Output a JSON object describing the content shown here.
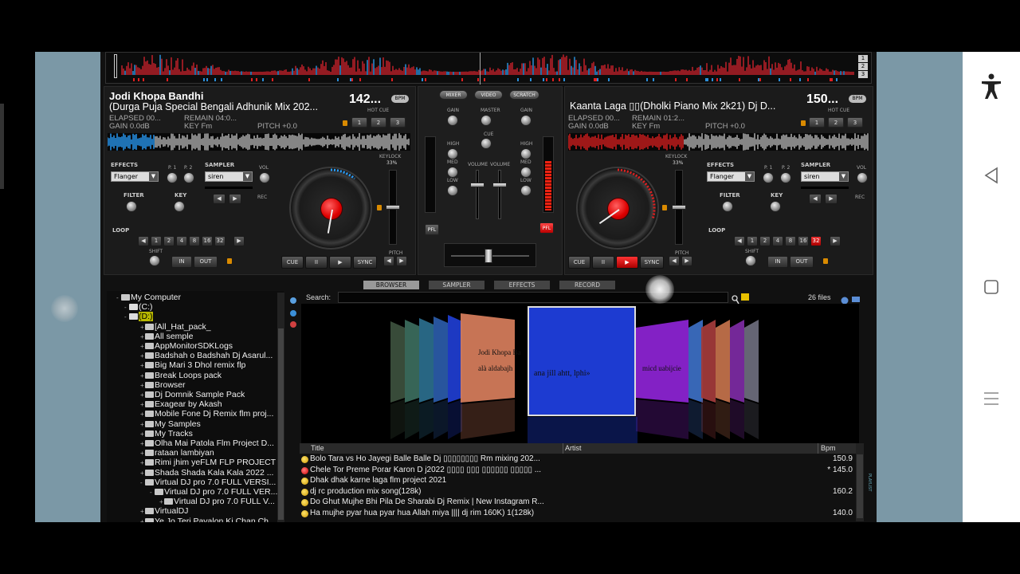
{
  "deck_left": {
    "title": "Jodi Khopa Bandhi",
    "subtitle": "(Durga Puja Special Bengali Adhunik Mix 202...",
    "bpm": "142...",
    "bpm_tag": "BPM",
    "elapsed": "ELAPSED 00...",
    "remain": "REMAIN 04:0...",
    "gain": "GAIN 0.0dB",
    "key": "KEY Fm",
    "pitch": "PITCH +0.0",
    "hotcue_label": "HOT CUE",
    "hotcues": [
      "1",
      "2",
      "3"
    ],
    "effects_label": "EFFECTS",
    "effect": "Flanger",
    "p1": "P. 1",
    "p2": "P. 2",
    "sampler_label": "SAMPLER",
    "sampler": "siren",
    "vol_label": "VOL",
    "filter_label": "FILTER",
    "key_label": "KEY",
    "rec_label": "REC",
    "loop_label": "LOOP",
    "loop_values": [
      "1",
      "2",
      "4",
      "8",
      "16",
      "32"
    ],
    "shift_label": "SHIFT",
    "in_label": "IN",
    "out_label": "OUT",
    "keylock_label": "KEYLOCK",
    "keylock_pct": "33%",
    "pitch_label": "PITCH",
    "cue": "CUE",
    "pause": "II",
    "play": "▶",
    "sync": "SYNC"
  },
  "deck_right": {
    "title": "Kaanta Laga ▯▯(Dholki Piano Mix 2k21) Dj D...",
    "bpm": "150...",
    "bpm_tag": "BPM",
    "elapsed": "ELAPSED 00...",
    "remain": "REMAIN 01:2...",
    "gain": "GAIN 0.0dB",
    "key": "KEY Fm",
    "pitch": "PITCH +0.0",
    "hotcue_label": "HOT CUE",
    "hotcues": [
      "1",
      "2",
      "3"
    ],
    "effects_label": "EFFECTS",
    "effect": "Flanger",
    "p1": "P. 1",
    "p2": "P. 2",
    "sampler_label": "SAMPLER",
    "sampler": "siren",
    "vol_label": "VOL",
    "filter_label": "FILTER",
    "key_label": "KEY",
    "rec_label": "REC",
    "loop_label": "LOOP",
    "loop_values": [
      "1",
      "2",
      "4",
      "8",
      "16",
      "32"
    ],
    "shift_label": "SHIFT",
    "in_label": "IN",
    "out_label": "OUT",
    "keylock_label": "KEYLOCK",
    "keylock_pct": "33%",
    "pitch_label": "PITCH",
    "cue": "CUE",
    "pause": "II",
    "play": "▶",
    "sync": "SYNC"
  },
  "mixer": {
    "tabs": [
      "MIXER",
      "VIDEO",
      "SCRATCH"
    ],
    "gain": "GAIN",
    "master": "MASTER",
    "cue": "CUE",
    "high": "HIGH",
    "med": "MED",
    "low": "LOW",
    "volume": "VOLUME",
    "pfl": "PFL"
  },
  "deck_numbers": [
    "1",
    "2",
    "3"
  ],
  "browser_tabs": [
    "BROWSER",
    "SAMPLER",
    "EFFECTS",
    "RECORD"
  ],
  "tree": [
    "My Computer",
    "(C:)",
    "(D:)",
    "[All_Hat_pack_",
    "All semple",
    "AppMonitorSDKLogs",
    "Badshah o Badshah Dj Asarul...",
    "Big Mari 3 Dhol remix flp",
    "Break Loops pack",
    "Browser",
    "Dj Domnik Sample Pack",
    "Exagear by Akash",
    "Mobile Fone Dj Remix flm proj...",
    "My Samples",
    "My Tracks",
    "Olha Mai Patola Flm Project D...",
    "rataan lambiyan",
    "Rimi jhim yeFLM FLP PROJECT",
    "Shada Shada Kala Kala 2022 ...",
    "Virtual DJ pro 7.0 FULL VERSI...",
    "Virtual DJ pro 7.0 FULL VER...",
    "Virtual DJ pro 7.0 FULL V...",
    "VirtualDJ",
    "Ye Jo Teri Payalon Ki Chan Ch..."
  ],
  "search_label": "Search:",
  "search_value": "",
  "files_count": "26 files",
  "coverflow": {
    "center_text": "ana jill ahtt, lphi»",
    "left_text": "Jodi Khopa Ba",
    "left_text2": "alà aldabajh",
    "right_text": "micd uabijcie"
  },
  "columns": {
    "title": "Title",
    "artist": "Artist",
    "bpm": "Bpm"
  },
  "tracks": [
    {
      "title": "Bolo Tara vs Ho Jayegi Balle Balle Dj ▯▯▯▯▯▯▯▯ Rm mixing 202...",
      "bpm": "150.9"
    },
    {
      "title": "Chele Tor Preme Porar Karon D j2022 ▯▯▯▯ ▯▯▯ ▯▯▯▯▯▯ ▯▯▯▯▯ ...",
      "bpm": "* 145.0"
    },
    {
      "title": "Dhak dhak karne laga flm project 2021",
      "bpm": ""
    },
    {
      "title": "dj rc production mix song(128k)",
      "bpm": "160.2"
    },
    {
      "title": "Do Ghut Mujhe Bhi Pila De Sharabi Dj Remix | New Instagram R...",
      "bpm": ""
    },
    {
      "title": "Ha mujhe pyar hua pyar hua Allah miya |||| dj rim 160K) 1(128k)",
      "bpm": "140.0"
    }
  ],
  "playlist_label": "PLAYLIST",
  "colors": {
    "accent_red": "#e02020",
    "waveform_blue": "#2aa0ff",
    "cover_blue": "#1d3bd1"
  }
}
